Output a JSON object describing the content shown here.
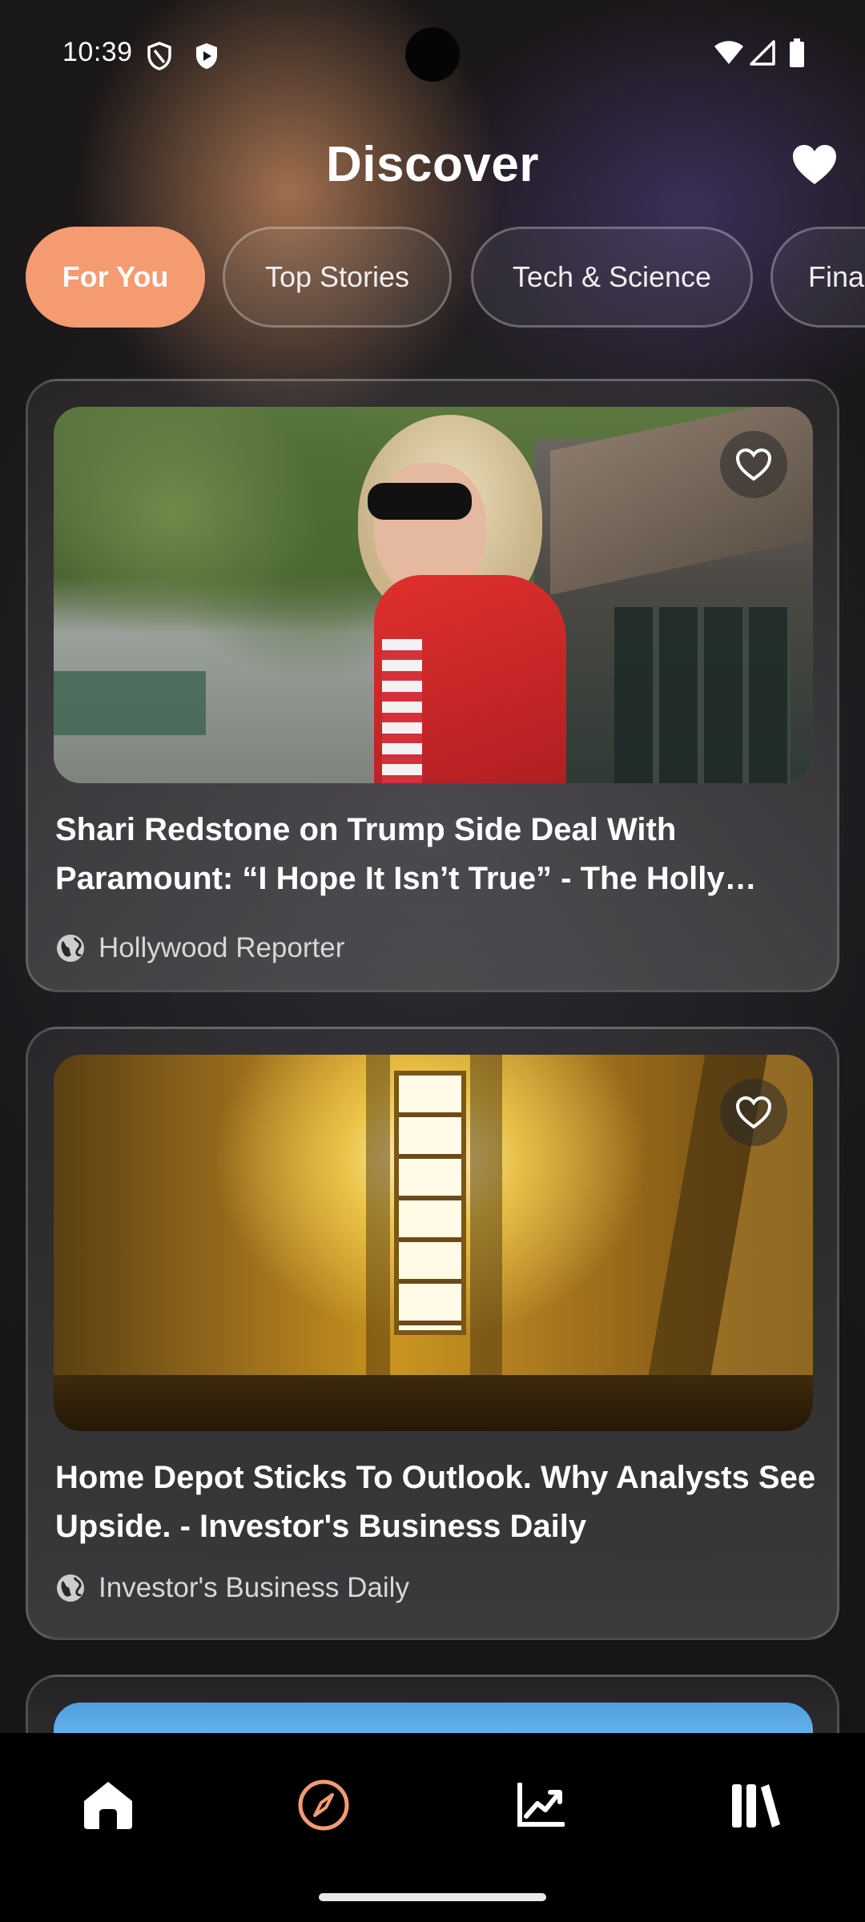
{
  "status_bar": {
    "time": "10:39",
    "icons": [
      "shield-outline-icon",
      "shield-filled-icon",
      "wifi-icon",
      "signal-icon",
      "battery-icon"
    ]
  },
  "header": {
    "title": "Discover",
    "favorites_icon": "heart-icon"
  },
  "tabs": [
    {
      "label": "For You",
      "active": true
    },
    {
      "label": "Top Stories",
      "active": false
    },
    {
      "label": "Tech & Science",
      "active": false
    },
    {
      "label": "Fina",
      "active": false
    }
  ],
  "articles": [
    {
      "headline": "Shari Redstone on Trump Side Deal With Paramount: “I Hope It Isn’t True” - The Holly…",
      "source": "Hollywood Reporter",
      "image": "woman-in-red-jacket-photo"
    },
    {
      "headline": "Home Depot Sticks To Outlook. Why Analysts See Upside. - Investor's Business Daily",
      "source": "Investor's Business Daily",
      "image": "sunbeam-through-window-photo"
    }
  ],
  "bottom_nav": [
    {
      "name": "home",
      "icon": "home-icon",
      "active": false
    },
    {
      "name": "discover",
      "icon": "compass-icon",
      "active": true
    },
    {
      "name": "markets",
      "icon": "trending-up-icon",
      "active": false
    },
    {
      "name": "library",
      "icon": "library-icon",
      "active": false
    }
  ],
  "colors": {
    "accent": "#f49b72",
    "background": "#151316",
    "nav_background": "#000000"
  }
}
